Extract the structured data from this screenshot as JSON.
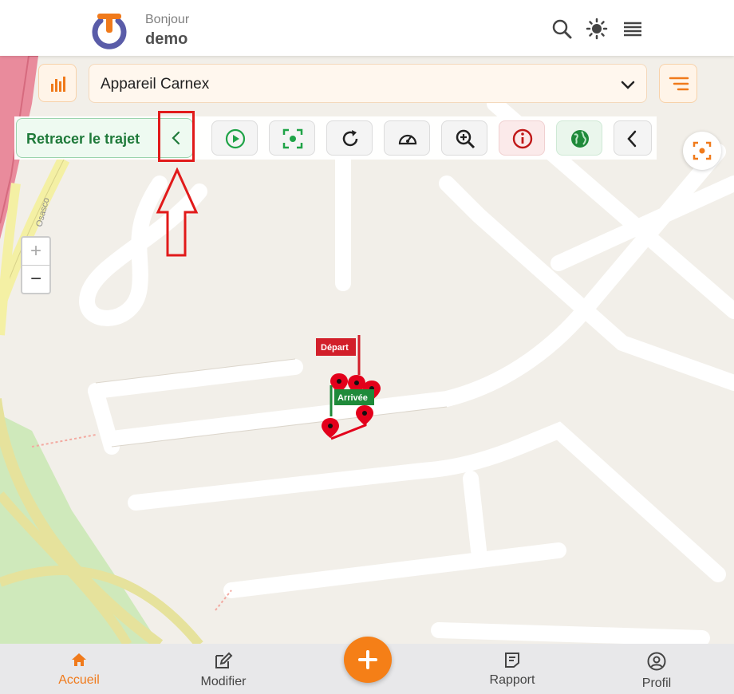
{
  "header": {
    "greeting": "Bonjour",
    "username": "demo"
  },
  "device_select": {
    "value": "Appareil Carnex"
  },
  "toolbar": {
    "retrace_label": "Retracer le trajet",
    "buttons": [
      "play-icon",
      "focus-icon",
      "refresh-icon",
      "speedometer-icon",
      "zoom-in-icon",
      "info-icon",
      "globe-icon",
      "chevron-left-icon"
    ]
  },
  "map": {
    "marker_start": "Départ",
    "marker_end": "Arrivée",
    "street_label": "Osasco",
    "zoom_in": "+",
    "zoom_out": "−"
  },
  "bottom_nav": {
    "home": "Accueil",
    "edit": "Modifier",
    "add": "+",
    "report": "Rapport",
    "profile": "Profil"
  },
  "colors": {
    "accent": "#f57f17",
    "green": "#1f7a3a",
    "highlight": "#e11a1a",
    "marker": "#e3001b"
  }
}
